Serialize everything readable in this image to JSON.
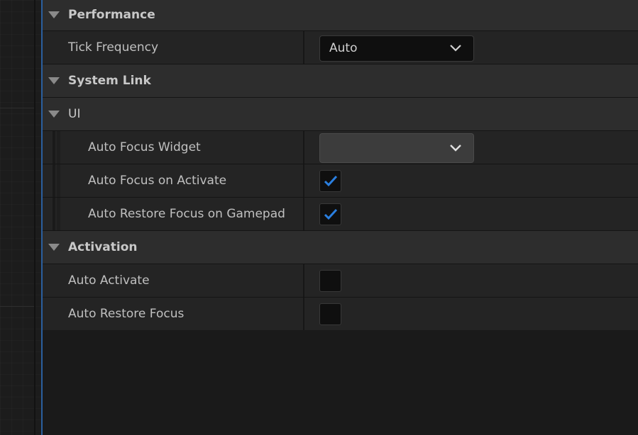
{
  "categories": {
    "performance": "Performance",
    "system_link": "System Link",
    "ui": "UI",
    "activation": "Activation"
  },
  "properties": {
    "tick_frequency": {
      "label": "Tick Frequency",
      "value": "Auto"
    },
    "auto_focus_widget": {
      "label": "Auto Focus Widget",
      "value": ""
    },
    "auto_focus_on_activate": {
      "label": "Auto Focus on Activate",
      "checked": true
    },
    "auto_restore_focus_on_gamepad": {
      "label": "Auto Restore Focus on Gamepad",
      "checked": true
    },
    "auto_activate": {
      "label": "Auto Activate",
      "checked": false
    },
    "auto_restore_focus": {
      "label": "Auto Restore Focus",
      "checked": false
    }
  },
  "colors": {
    "checkmark": "#2a7fe0",
    "accent": "#2b5f9e"
  },
  "icons": {
    "expand": "triangle-down-icon",
    "dropdown": "chevron-down-icon",
    "check": "checkmark-icon"
  }
}
